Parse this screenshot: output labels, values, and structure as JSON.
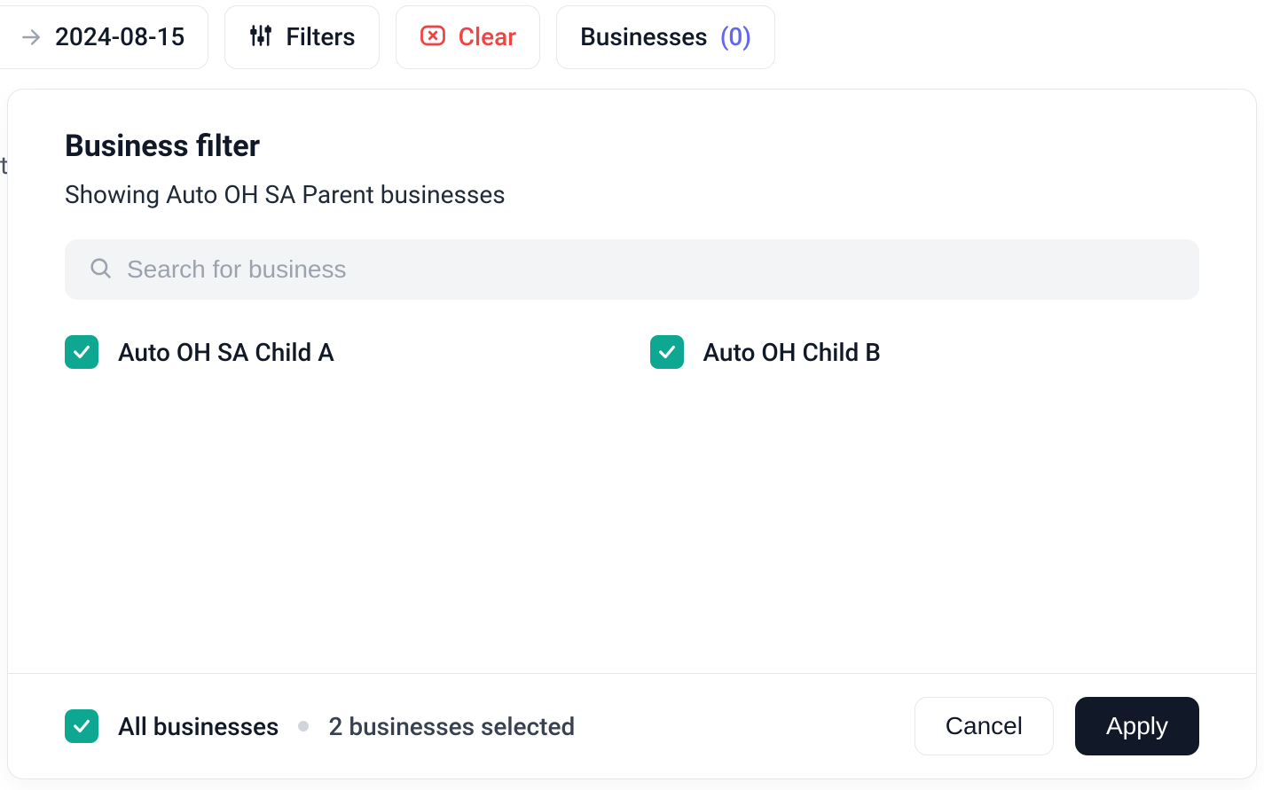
{
  "toolbar": {
    "date": "2024-08-15",
    "filters_label": "Filters",
    "clear_label": "Clear",
    "businesses_label": "Businesses",
    "businesses_count": "(0)"
  },
  "modal": {
    "title": "Business filter",
    "subtitle": "Showing Auto OH SA Parent businesses",
    "search_placeholder": "Search for business",
    "businesses": [
      {
        "label": "Auto OH SA Child A",
        "checked": true
      },
      {
        "label": "Auto OH Child B",
        "checked": true
      }
    ],
    "footer": {
      "all_label": "All businesses",
      "all_checked": true,
      "selected_text": "2 businesses selected",
      "cancel_label": "Cancel",
      "apply_label": "Apply"
    }
  },
  "background": {
    "partial_text": "t"
  }
}
